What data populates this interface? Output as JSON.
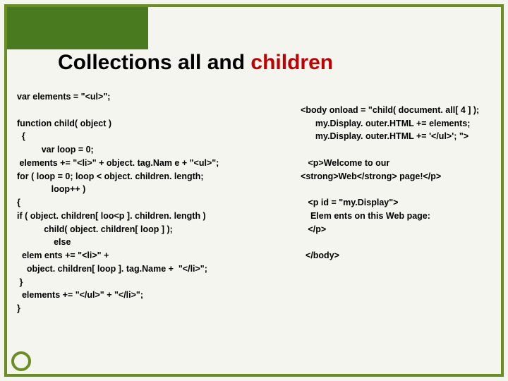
{
  "title_pre": "Collections ",
  "title_all": "all",
  "title_and": " and ",
  "title_children": "children",
  "left_code": "var elements = \"<ul>\";\n\nfunction child( object )\n  {\n          var loop = 0;\n elements += \"<li>\" + object. tag.Nam e + \"<ul>\";\nfor ( loop = 0; loop < object. children. length;\n              loop++ )\n{\nif ( object. children[ loo<p ]. children. length )\n           child( object. children[ loop ] );\n               else\n  elem ents += \"<li>\" +\n    object. children[ loop ]. tag.Name +  \"</li>\";\n }\n  elements += \"</ul>\" + \"</li>\";\n}",
  "right_code": "\n<body onload = \"child( document. all[ 4 ] );\n      my.Display. outer.HTML += elements;\n      my.Display. outer.HTML += '</ul>'; \">\n\n   <p>Welcome to our\n<strong>Web</strong> page!</p>\n\n   <p id = \"my.Display\">\n    Elem ents on this Web page:\n   </p>\n\n  </body>"
}
